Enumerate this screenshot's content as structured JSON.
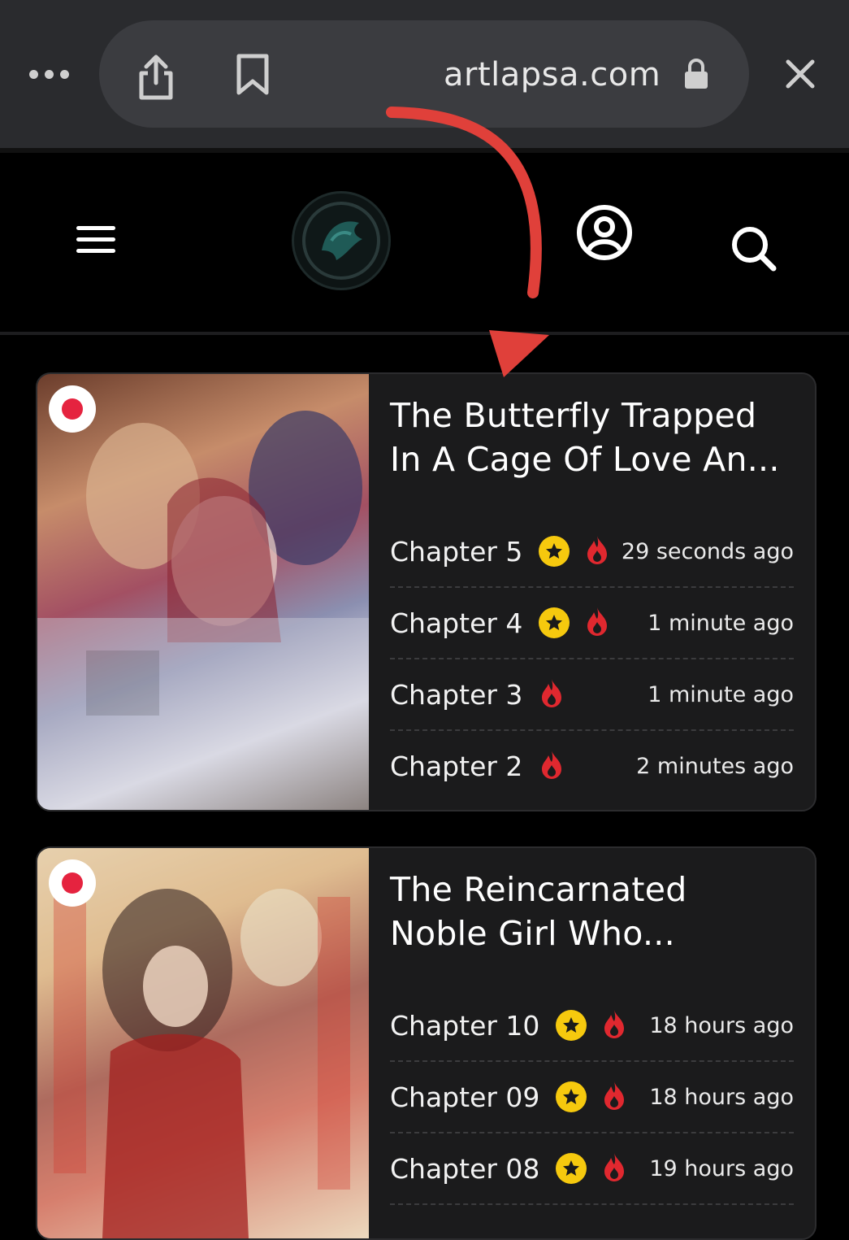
{
  "browser": {
    "url": "artlapsa.com",
    "icons": [
      "more-dots-icon",
      "share-icon",
      "bookmark-icon",
      "lock-icon",
      "close-icon"
    ]
  },
  "header": {
    "icons": [
      "menu-icon",
      "site-logo",
      "user-icon",
      "search-icon"
    ]
  },
  "colors": {
    "browser_bg": "#2a2b2e",
    "pill_bg": "#3b3c40",
    "card_bg": "#1b1b1c",
    "arrow": "#e0403a",
    "star": "#f6c90e",
    "fire": "#e0282f"
  },
  "series": [
    {
      "title": "The Butterfly Trapped In A Cage Of Love An...",
      "chapters": [
        {
          "label": "Chapter 5",
          "star": true,
          "fire": true,
          "time": "29 seconds ago"
        },
        {
          "label": "Chapter 4",
          "star": true,
          "fire": true,
          "time": "1 minute ago"
        },
        {
          "label": "Chapter 3",
          "star": false,
          "fire": true,
          "time": "1 minute ago"
        },
        {
          "label": "Chapter 2",
          "star": false,
          "fire": true,
          "time": "2 minutes ago"
        }
      ]
    },
    {
      "title": "The Reincarnated Noble Girl Who...",
      "chapters": [
        {
          "label": "Chapter 10",
          "star": true,
          "fire": true,
          "time": "18 hours ago"
        },
        {
          "label": "Chapter 09",
          "star": true,
          "fire": true,
          "time": "18 hours ago"
        },
        {
          "label": "Chapter 08",
          "star": true,
          "fire": true,
          "time": "19 hours ago"
        }
      ]
    }
  ]
}
